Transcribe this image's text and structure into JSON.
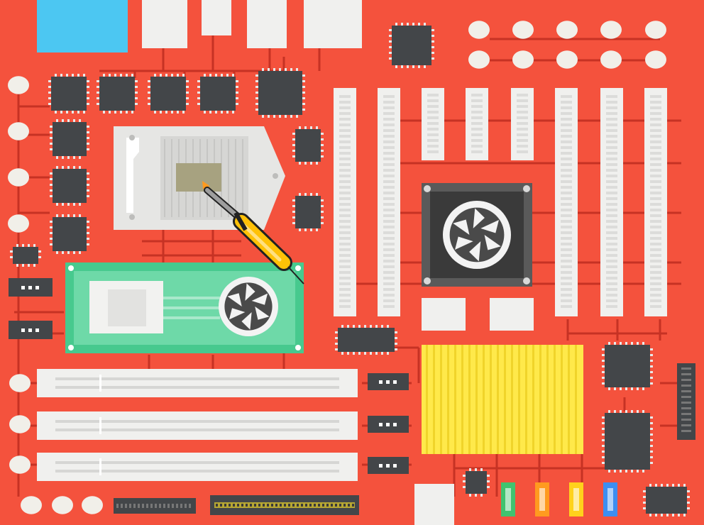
{
  "scene": {
    "type": "pixel-art motherboard",
    "colors": {
      "board": "#f4523d",
      "trace": "#c63224",
      "chip": "#434649",
      "chip_pin": "#e9e9e9",
      "cap": "#f1efe9",
      "slot": "#f0f0ee",
      "cpu_socket": "#e6e6e4",
      "gpu_card": "#47c98e",
      "heatsink": "#ffe94a",
      "cyan_block": "#4cc7f2"
    },
    "icons": {
      "tool": "soldering-iron-icon",
      "fan": "fan-icon"
    },
    "sata_port_colors": [
      "#40c36f",
      "#ff9a1f",
      "#ffd21c",
      "#3d8ef0"
    ]
  }
}
